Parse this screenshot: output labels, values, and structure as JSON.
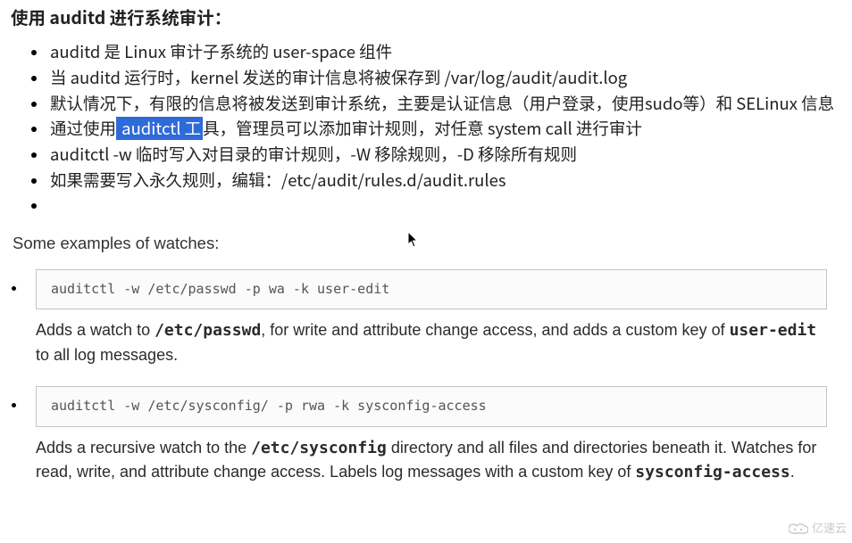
{
  "heading": "使用 auditd 进行系统审计：",
  "bullets": [
    {
      "pre": "auditd 是 Linux 审计子系统的 user-space 组件",
      "hl": "",
      "post": ""
    },
    {
      "pre": "当 auditd 运行时，kernel 发送的审计信息将被保存到 /var/log/audit/audit.log",
      "hl": "",
      "post": ""
    },
    {
      "pre": "默认情况下，有限的信息将被发送到审计系统，主要是认证信息（用户登录，使用sudo等）和 SELinux 信息",
      "hl": "",
      "post": ""
    },
    {
      "pre": "通过使用",
      "hl": " auditctl 工",
      "post": "具，管理员可以添加审计规则，对任意 system call 进行审计"
    },
    {
      "pre": "auditctl -w 临时写入对目录的审计规则，-W 移除规则，-D 移除所有规则",
      "hl": "",
      "post": ""
    },
    {
      "pre": "如果需要写入永久规则，编辑：/etc/audit/rules.d/audit.rules",
      "hl": "",
      "post": ""
    },
    {
      "pre": "",
      "hl": "",
      "post": ""
    }
  ],
  "examples_heading": "Some examples of watches:",
  "examples": [
    {
      "code": "auditctl -w /etc/passwd -p wa -k user-edit",
      "desc_pre1": "Adds a watch to ",
      "desc_mono1": "/etc/passwd",
      "desc_mid": ", for write and attribute change access, and adds a custom key of ",
      "desc_mono2": "user-edit",
      "desc_post": " to all log messages."
    },
    {
      "code": "auditctl -w /etc/sysconfig/ -p rwa -k sysconfig-access",
      "desc_pre1": "Adds a recursive watch to the ",
      "desc_mono1": "/etc/sysconfig",
      "desc_mid": " directory and all files and directories beneath it. Watches for read, write, and attribute change access. Labels log messages with a custom key of ",
      "desc_mono2": "sysconfig-access",
      "desc_post": "."
    }
  ],
  "watermark": "亿速云"
}
